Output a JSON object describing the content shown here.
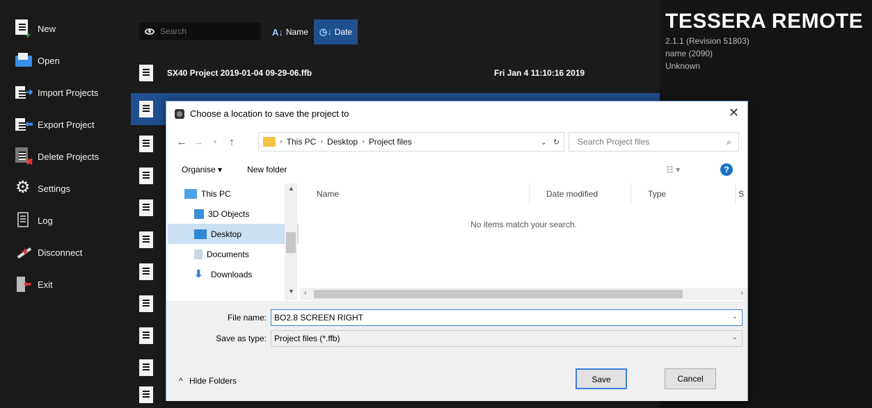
{
  "sidebar": {
    "items": [
      {
        "label": "New",
        "icon": "new-project-icon"
      },
      {
        "label": "Open",
        "icon": "open-folder-icon"
      },
      {
        "label": "Import Projects",
        "icon": "import-icon"
      },
      {
        "label": "Export Project",
        "icon": "export-icon"
      },
      {
        "label": "Delete Projects",
        "icon": "delete-icon"
      },
      {
        "label": "Settings",
        "icon": "gear-icon"
      },
      {
        "label": "Log",
        "icon": "log-icon"
      },
      {
        "label": "Disconnect",
        "icon": "disconnect-icon"
      },
      {
        "label": "Exit",
        "icon": "exit-icon"
      }
    ]
  },
  "list": {
    "search_placeholder": "Search",
    "sort_name": "Name",
    "sort_date": "Date",
    "rows": [
      {
        "name": "SX40 Project 2019-01-04 09-29-06.ffb",
        "date": "Fri Jan 4 11:10:16 2019"
      }
    ]
  },
  "info": {
    "app_title": "TESSERA REMOTE",
    "version": "2.1.1 (Revision 51803)",
    "name_line": "name (2090)",
    "status": "Unknown"
  },
  "dialog": {
    "title": "Choose a location to save the project to",
    "close": "✕",
    "breadcrumbs": [
      "This PC",
      "Desktop",
      "Project files"
    ],
    "search_placeholder": "Search Project files",
    "organise": "Organise ▾",
    "new_folder": "New folder",
    "help": "?",
    "nav_items": [
      {
        "label": "This PC",
        "icon": "computer-icon",
        "color": "#4aa3e8"
      },
      {
        "label": "3D Objects",
        "icon": "3d-objects-icon",
        "color": "#3b8fd9"
      },
      {
        "label": "Desktop",
        "icon": "desktop-icon",
        "color": "#2f86d6"
      },
      {
        "label": "Documents",
        "icon": "documents-icon",
        "color": "#c9d6e3"
      },
      {
        "label": "Downloads",
        "icon": "downloads-icon",
        "color": "#2f7fd6"
      }
    ],
    "columns": [
      "Name",
      "Date modified",
      "Type",
      "S"
    ],
    "empty_message": "No items match your search.",
    "file_name_label": "File name:",
    "file_name_value": "BO2.8 SCREEN RIGHT",
    "save_type_label": "Save as type:",
    "save_type_value": "Project files (*.ffb)",
    "hide_folders": "Hide Folders",
    "save": "Save",
    "cancel": "Cancel"
  }
}
